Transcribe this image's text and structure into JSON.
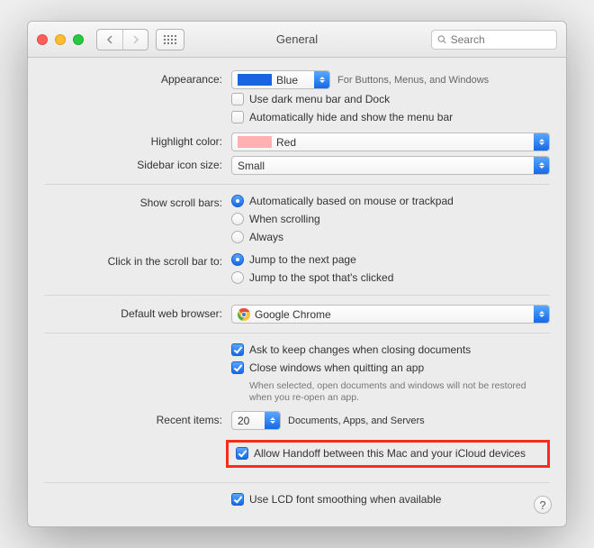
{
  "window": {
    "title": "General"
  },
  "search": {
    "placeholder": "Search"
  },
  "labels": {
    "appearance": "Appearance:",
    "highlight": "Highlight color:",
    "sidebar": "Sidebar icon size:",
    "scrollbars": "Show scroll bars:",
    "clickbar": "Click in the scroll bar to:",
    "browser": "Default web browser:",
    "recent": "Recent items:"
  },
  "appearance": {
    "value": "Blue",
    "hint": "For Buttons, Menus, and Windows",
    "darkmenu": "Use dark menu bar and Dock",
    "autohide": "Automatically hide and show the menu bar"
  },
  "highlight": {
    "value": "Red"
  },
  "sidebar": {
    "value": "Small"
  },
  "scroll": {
    "auto": "Automatically based on mouse or trackpad",
    "when": "When scrolling",
    "always": "Always"
  },
  "click": {
    "next": "Jump to the next page",
    "spot": "Jump to the spot that's clicked"
  },
  "browser": {
    "value": "Google Chrome"
  },
  "docs": {
    "ask": "Ask to keep changes when closing documents",
    "close": "Close windows when quitting an app",
    "close_hint": "When selected, open documents and windows will not be restored when you re-open an app."
  },
  "recent": {
    "value": "20",
    "suffix": "Documents, Apps, and Servers"
  },
  "handoff": "Allow Handoff between this Mac and your iCloud devices",
  "lcd": "Use LCD font smoothing when available",
  "help": "?"
}
